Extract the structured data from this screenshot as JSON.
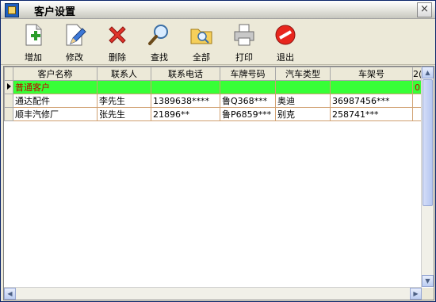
{
  "window": {
    "title": "客户设置",
    "close_label": "×"
  },
  "toolbar": {
    "add": "增加",
    "edit": "修改",
    "delete": "删除",
    "find": "查找",
    "all": "全部",
    "print": "打印",
    "exit": "退出"
  },
  "grid": {
    "headers": [
      "客户名称",
      "联系人",
      "联系电话",
      "车牌号码",
      "汽车类型",
      "车架号",
      "2("
    ],
    "rows": [
      [
        "普通客户",
        "",
        "",
        "",
        "",
        "",
        "0"
      ],
      [
        "通达配件",
        "李先生",
        "1389638****",
        "鲁Q368***",
        "奥迪",
        "36987456***",
        ""
      ],
      [
        "顺丰汽修厂",
        "张先生",
        "21896**",
        "鲁P6859***",
        "别克",
        "258741***",
        ""
      ]
    ],
    "selected_row": 0
  },
  "colors": {
    "selected_row_bg": "#37ff37",
    "selected_row_text": "#c00000"
  }
}
